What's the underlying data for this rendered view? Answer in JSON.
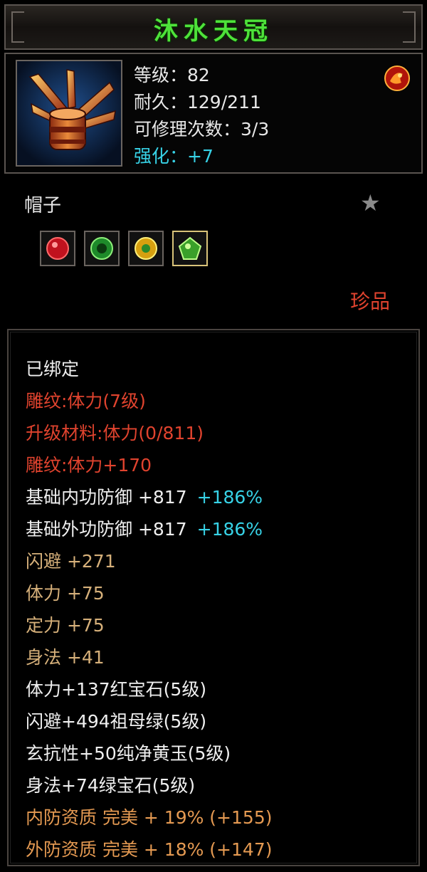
{
  "item": {
    "name": "沐水天冠",
    "stats": [
      {
        "label": "等级：82",
        "color": "white"
      },
      {
        "label": "耐久：129/211",
        "color": "white"
      },
      {
        "label": "可修理次数：3/3",
        "color": "white"
      },
      {
        "label": "强化：+7",
        "color": "cyan"
      }
    ],
    "category": "帽子",
    "rarity": "珍品",
    "sockets": [
      {
        "gem": "ruby-gem-icon"
      },
      {
        "gem": "emerald-gem-icon"
      },
      {
        "gem": "yellow-jade-gem-icon"
      },
      {
        "gem": "green-sapphire-gem-icon"
      }
    ]
  },
  "properties": [
    {
      "text": "已绑定",
      "color": "white"
    },
    {
      "text": "雕纹:体力(7级)",
      "color": "red"
    },
    {
      "text": "升级材料:体力(0/811)",
      "color": "red"
    },
    {
      "text": "雕纹:体力+170",
      "color": "red"
    },
    {
      "text": "基础内功防御  +817",
      "color": "white",
      "pct": "+186%"
    },
    {
      "text": "基础外功防御  +817",
      "color": "white",
      "pct": "+186%"
    },
    {
      "text": "闪避  +271",
      "color": "tan"
    },
    {
      "text": "体力  +75",
      "color": "tan"
    },
    {
      "text": "定力  +75",
      "color": "tan"
    },
    {
      "text": "身法  +41",
      "color": "tan"
    },
    {
      "text": "体力+137红宝石(5级)",
      "color": "white"
    },
    {
      "text": "闪避+494祖母绿(5级)",
      "color": "white"
    },
    {
      "text": "玄抗性+50纯净黄玉(5级)",
      "color": "white"
    },
    {
      "text": "身法+74绿宝石(5级)",
      "color": "white"
    },
    {
      "text": "内防资质  完美  +  19% (+155)",
      "color": "orange"
    },
    {
      "text": "外防资质  完美  +  18% (+147)",
      "color": "orange"
    }
  ],
  "colors": {
    "title_green": "#4ee23a",
    "red": "#e0432e",
    "cyan": "#37d2e6",
    "tan": "#d6b07a",
    "orange": "#e59a52"
  }
}
